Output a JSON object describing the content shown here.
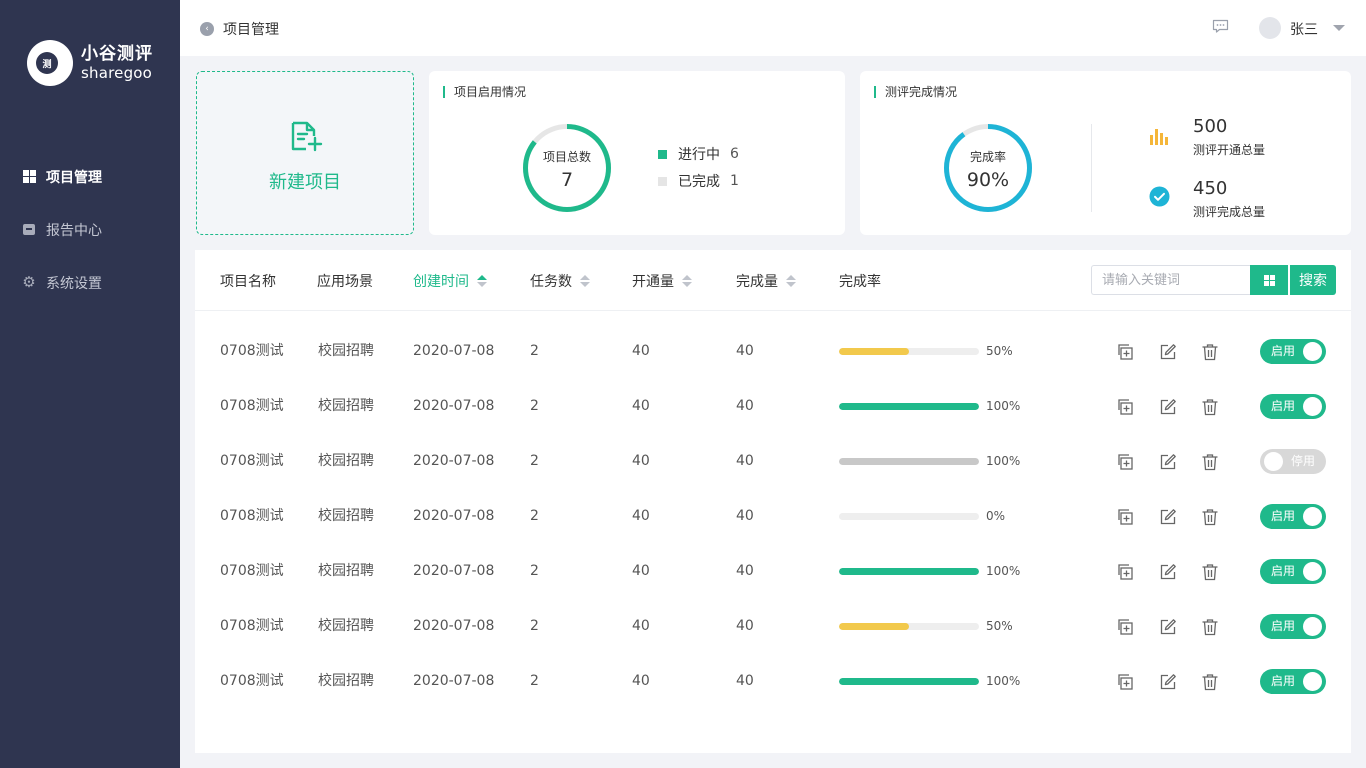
{
  "brand": {
    "name_cn": "小谷测评",
    "name_en": "sharegoo",
    "mark": "测"
  },
  "sidebar": {
    "items": [
      {
        "label": "项目管理",
        "icon": "grid-icon",
        "active": true
      },
      {
        "label": "报告中心",
        "icon": "box-icon",
        "active": false
      },
      {
        "label": "系统设置",
        "icon": "gear-icon",
        "active": false
      }
    ]
  },
  "header": {
    "title": "项目管理",
    "username": "张三"
  },
  "new_project": {
    "label": "新建项目"
  },
  "usage_card": {
    "title": "项目启用情况",
    "ring_label": "项目总数",
    "ring_value": "7",
    "ring_fraction": 0.857,
    "legend": [
      {
        "label": "进行中",
        "value": "6",
        "color": "#1fb98b"
      },
      {
        "label": "已完成",
        "value": "1",
        "color": "#e5e5e5"
      }
    ]
  },
  "completion_card": {
    "title": "测评完成情况",
    "ring_label": "完成率",
    "ring_value": "90%",
    "ring_fraction": 0.9,
    "stats": [
      {
        "value": "500",
        "label": "测评开通总量",
        "icon": "bar-chart-icon",
        "color": "#f5b639"
      },
      {
        "value": "450",
        "label": "测评完成总量",
        "icon": "check-circle-icon",
        "color": "#1eb4d6"
      }
    ]
  },
  "table": {
    "columns": [
      "项目名称",
      "应用场景",
      "创建时间",
      "任务数",
      "开通量",
      "完成量",
      "完成率"
    ],
    "search_placeholder": "请输入关键词",
    "search_label": "搜索",
    "rows": [
      {
        "name": "0708测试",
        "scene": "校园招聘",
        "date": "2020-07-08",
        "tasks": "2",
        "opened": "40",
        "done": "40",
        "rate": "50%",
        "rate_value": 0.5,
        "bar_color": "#f2c94c",
        "status": "启用",
        "enabled": true
      },
      {
        "name": "0708测试",
        "scene": "校园招聘",
        "date": "2020-07-08",
        "tasks": "2",
        "opened": "40",
        "done": "40",
        "rate": "100%",
        "rate_value": 1.0,
        "bar_color": "#1fb98b",
        "status": "启用",
        "enabled": true
      },
      {
        "name": "0708测试",
        "scene": "校园招聘",
        "date": "2020-07-08",
        "tasks": "2",
        "opened": "40",
        "done": "40",
        "rate": "100%",
        "rate_value": 1.0,
        "bar_color": "#c8c8c8",
        "status": "停用",
        "enabled": false
      },
      {
        "name": "0708测试",
        "scene": "校园招聘",
        "date": "2020-07-08",
        "tasks": "2",
        "opened": "40",
        "done": "40",
        "rate": "0%",
        "rate_value": 0.0,
        "bar_color": "#1fb98b",
        "status": "启用",
        "enabled": true
      },
      {
        "name": "0708测试",
        "scene": "校园招聘",
        "date": "2020-07-08",
        "tasks": "2",
        "opened": "40",
        "done": "40",
        "rate": "100%",
        "rate_value": 1.0,
        "bar_color": "#1fb98b",
        "status": "启用",
        "enabled": true
      },
      {
        "name": "0708测试",
        "scene": "校园招聘",
        "date": "2020-07-08",
        "tasks": "2",
        "opened": "40",
        "done": "40",
        "rate": "50%",
        "rate_value": 0.5,
        "bar_color": "#f2c94c",
        "status": "启用",
        "enabled": true
      },
      {
        "name": "0708测试",
        "scene": "校园招聘",
        "date": "2020-07-08",
        "tasks": "2",
        "opened": "40",
        "done": "40",
        "rate": "100%",
        "rate_value": 1.0,
        "bar_color": "#1fb98b",
        "status": "启用",
        "enabled": true
      }
    ]
  },
  "colors": {
    "accent": "#1fb98b",
    "sidebar": "#2f3550",
    "ring_blue": "#1eb4d6"
  }
}
